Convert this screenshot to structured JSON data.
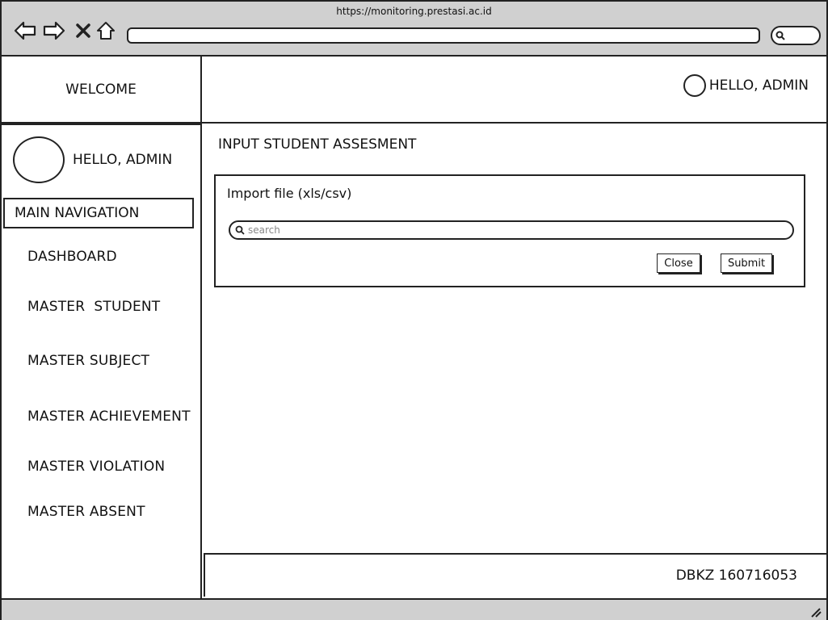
{
  "browser": {
    "url": "https://monitoring.prestasi.ac.id",
    "icons": [
      "back-arrow-icon",
      "forward-arrow-icon",
      "close-x-icon",
      "home-icon",
      "search-icon"
    ]
  },
  "header": {
    "welcome": "WELCOME",
    "user_greeting": "HELLO, ADMIN"
  },
  "sidebar": {
    "user_greeting": "HELLO, ADMIN",
    "nav_header": "MAIN NAVIGATION",
    "items": [
      {
        "label": "DASHBOARD"
      },
      {
        "label": "MASTER  STUDENT"
      },
      {
        "label": "MASTER SUBJECT"
      },
      {
        "label": "MASTER ACHIEVEMENT"
      },
      {
        "label": "MASTER VIOLATION"
      },
      {
        "label": "MASTER ABSENT"
      }
    ]
  },
  "main": {
    "title": "INPUT STUDENT ASSESMENT",
    "import": {
      "label": "Import file (xls/csv)",
      "placeholder": "search",
      "close_label": "Close",
      "submit_label": "Submit"
    }
  },
  "footer": {
    "text": "DBKZ 160716053"
  }
}
